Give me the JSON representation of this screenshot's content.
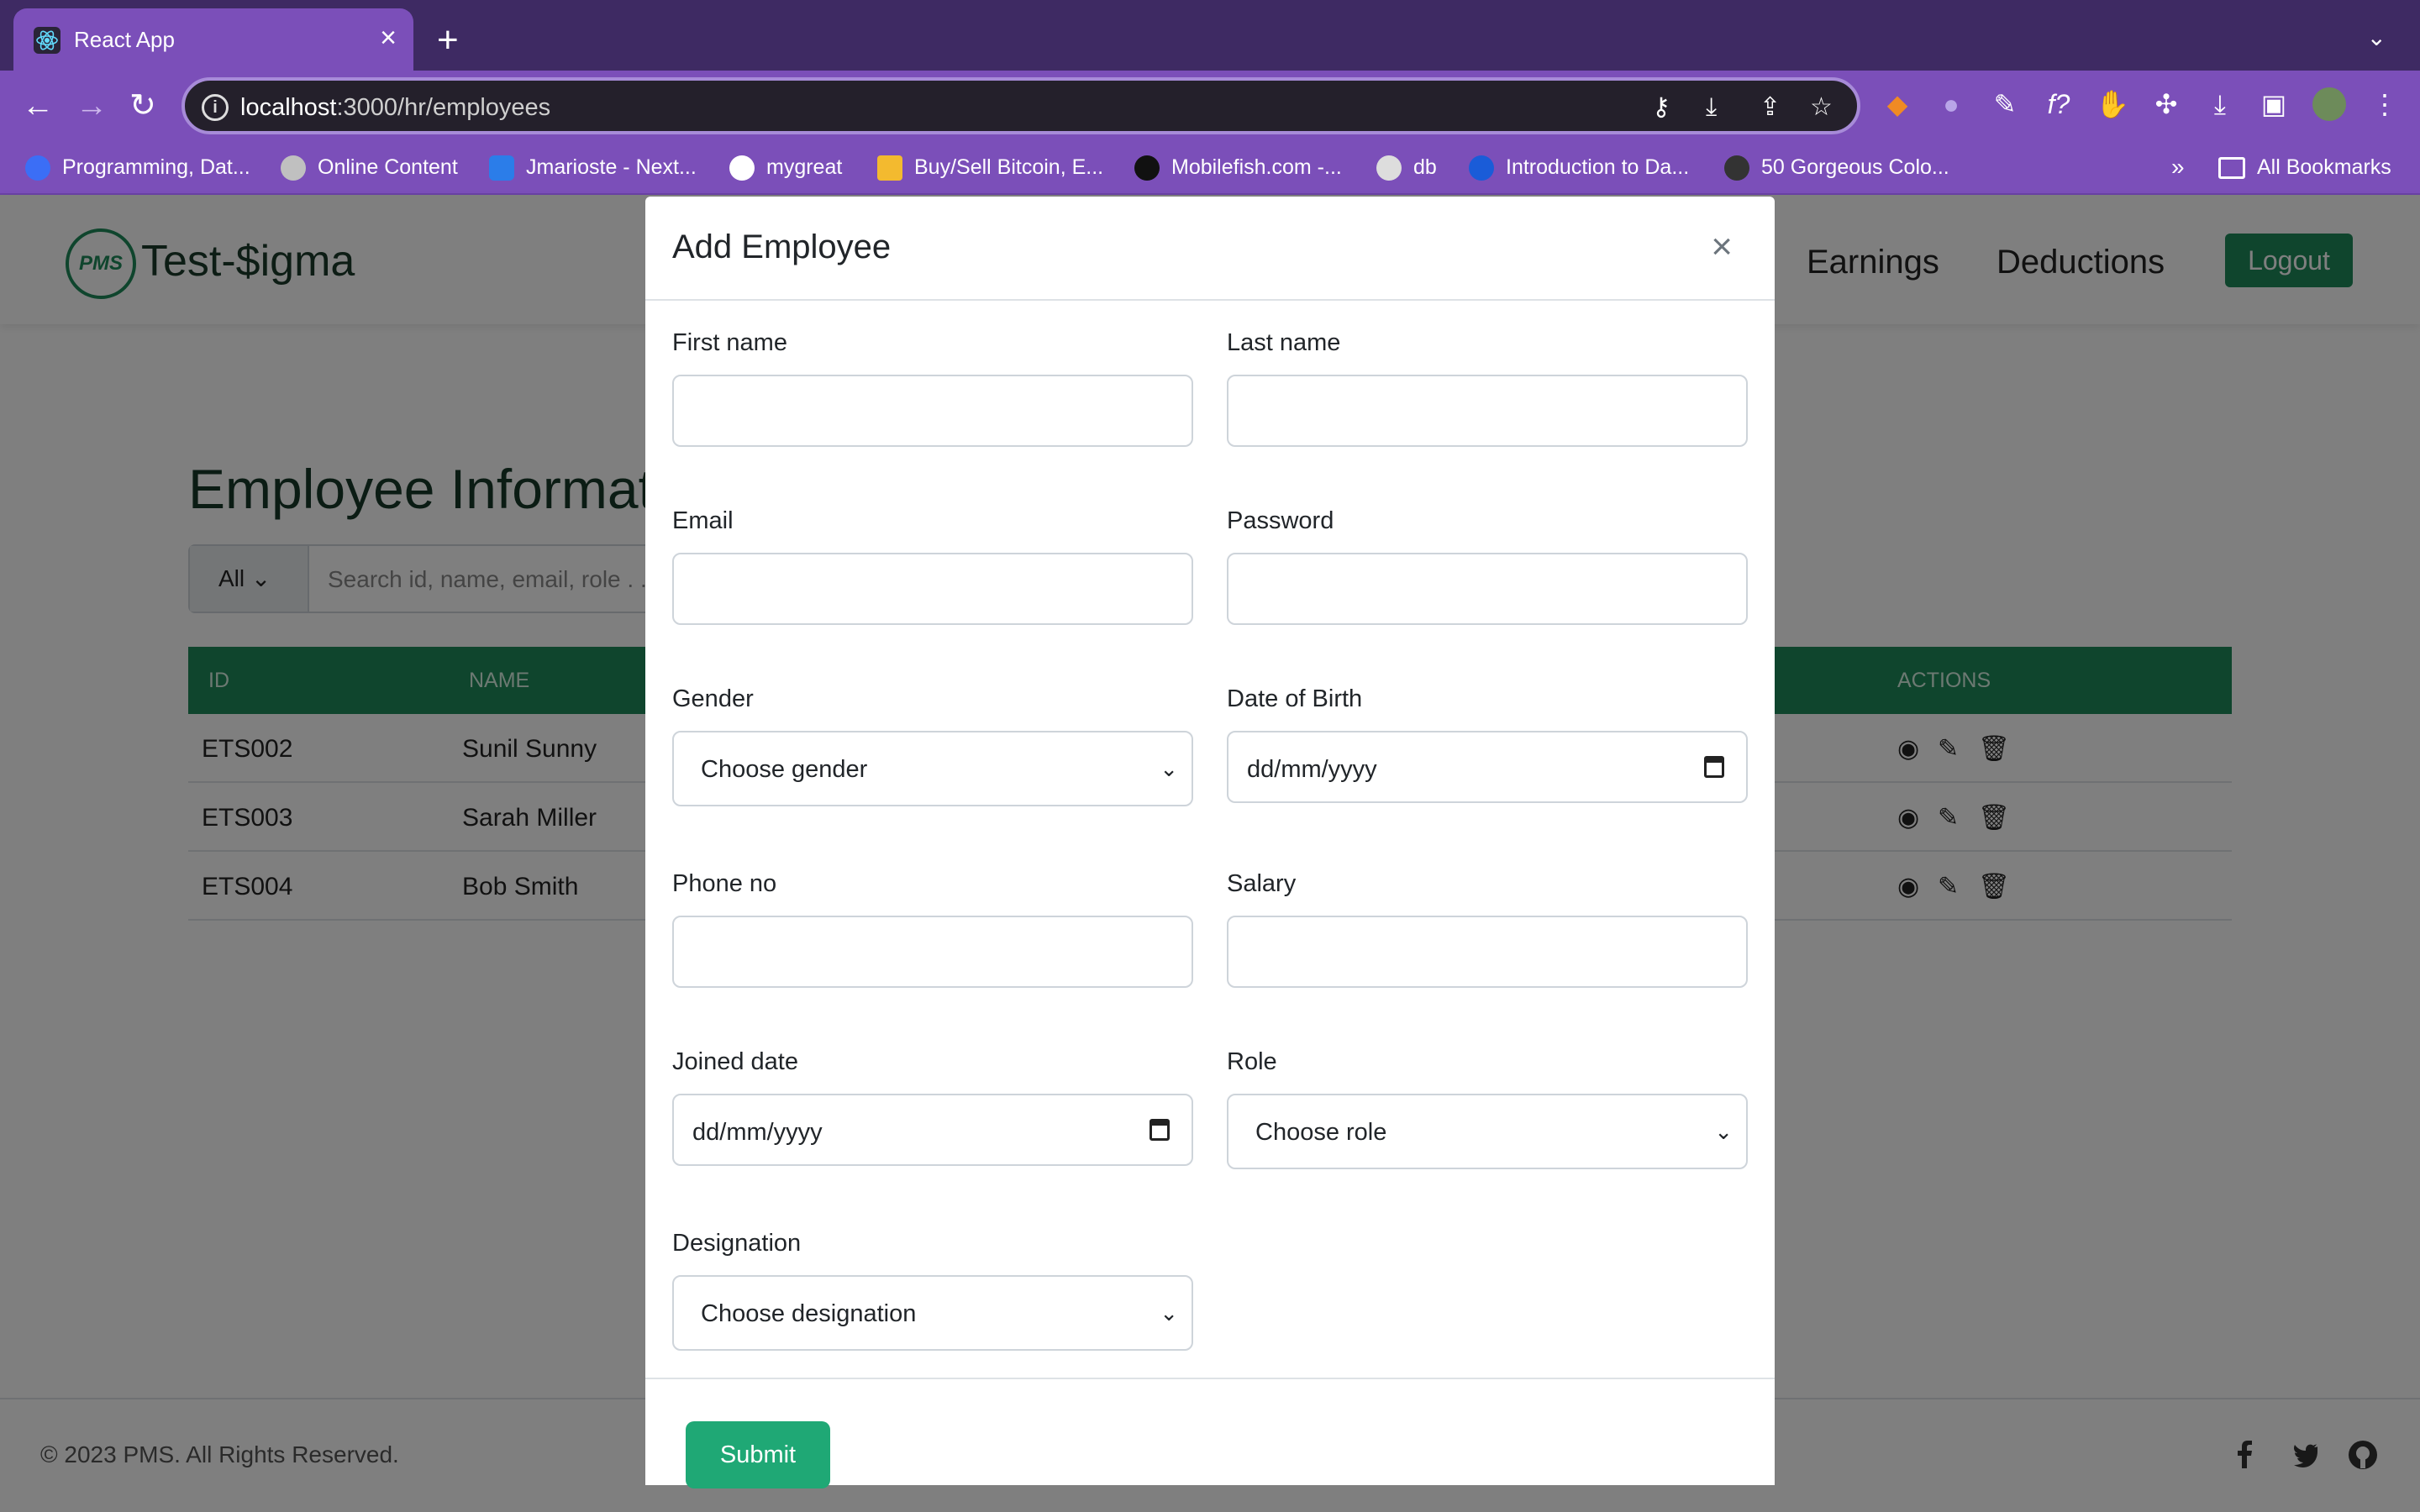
{
  "browser": {
    "tab_title": "React App",
    "tab_close": "×",
    "new_tab": "+",
    "url_host": "localhost",
    "url_path": ":3000/hr/employees",
    "bookmarks": [
      {
        "label": "Programming, Dat...",
        "color": "#3b6ef6"
      },
      {
        "label": "Online Content",
        "color": "#c0c0c0"
      },
      {
        "label": "Jmarioste - Next...",
        "color": "#2b7de9"
      },
      {
        "label": "mygreat",
        "color": "#ffffff"
      },
      {
        "label": "Buy/Sell Bitcoin, E...",
        "color": "#f3ba2f"
      },
      {
        "label": "Mobilefish.com -...",
        "color": "#111111"
      },
      {
        "label": "db",
        "color": "#dddddd"
      },
      {
        "label": "Introduction to Da...",
        "color": "#1a5cd8"
      },
      {
        "label": "50 Gorgeous Colo...",
        "color": "#333333"
      }
    ],
    "more_bookmarks": "»",
    "all_bookmarks": "All Bookmarks"
  },
  "app": {
    "logo_text": "PMS",
    "brand": "Test-$igma",
    "nav": {
      "earnings": "Earnings",
      "deductions": "Deductions",
      "logout": "Logout"
    },
    "page_title": "Employee Informatio",
    "filter": {
      "selected": "All",
      "search_placeholder": "Search id, name, email, role . . ."
    },
    "table": {
      "headers": {
        "id": "ID",
        "name": "NAME",
        "actions": "ACTIONS"
      },
      "rows": [
        {
          "id": "ETS002",
          "name": "Sunil Sunny"
        },
        {
          "id": "ETS003",
          "name": "Sarah Miller"
        },
        {
          "id": "ETS004",
          "name": "Bob Smith"
        }
      ]
    },
    "footer": "© 2023 PMS. All Rights Reserved."
  },
  "modal": {
    "title": "Add Employee",
    "close": "×",
    "labels": {
      "first_name": "First name",
      "last_name": "Last name",
      "email": "Email",
      "password": "Password",
      "gender": "Gender",
      "dob": "Date of Birth",
      "phone": "Phone no",
      "salary": "Salary",
      "joined": "Joined date",
      "role": "Role",
      "designation": "Designation"
    },
    "values": {
      "gender": "Choose gender",
      "dob": "dd/mm/yyyy",
      "joined": "dd/mm/yyyy",
      "role": "Choose role",
      "designation": "Choose designation"
    },
    "submit": "Submit"
  },
  "colors": {
    "primary": "#1f8a5a",
    "submit": "#1fa875",
    "browser": "#7b4fb9"
  }
}
